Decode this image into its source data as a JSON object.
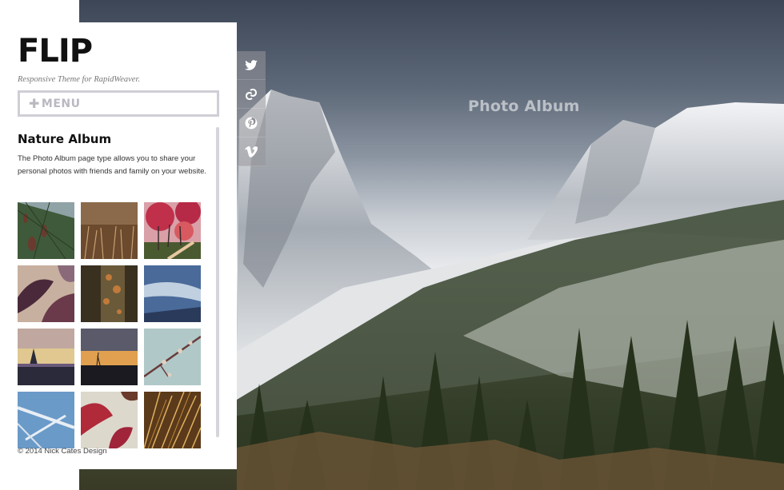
{
  "site": {
    "logo": "FLIP",
    "tagline": "Responsive Theme for RapidWeaver."
  },
  "menu": {
    "label": "MENU",
    "icon": "plus-icon"
  },
  "album": {
    "title": "Nature Album",
    "description": "The Photo Album page type allows you to share your personal photos with friends and family on your website."
  },
  "hero": {
    "title": "Photo Album"
  },
  "social": [
    {
      "name": "twitter-icon"
    },
    {
      "name": "delicious-icon"
    },
    {
      "name": "pinterest-icon"
    },
    {
      "name": "vimeo-icon"
    }
  ],
  "thumbnails": [
    {
      "name": "thumb-pine-cones",
      "colors": [
        "#3f5a3a",
        "#8fa3a6",
        "#6b3a2e"
      ]
    },
    {
      "name": "thumb-dry-grass",
      "colors": [
        "#6b4a2e",
        "#a3805a",
        "#3e2a1c"
      ]
    },
    {
      "name": "thumb-autumn-trees",
      "colors": [
        "#c0304a",
        "#d9a0a8",
        "#4a5a30"
      ]
    },
    {
      "name": "thumb-leaves",
      "colors": [
        "#4a2a3a",
        "#8a6a7a",
        "#c8b0a0"
      ]
    },
    {
      "name": "thumb-bark-lichen",
      "colors": [
        "#3a3020",
        "#c07a3a",
        "#6a5a3a"
      ]
    },
    {
      "name": "thumb-sky-clouds",
      "colors": [
        "#4a6a9a",
        "#c0d0e0",
        "#2a3a5a"
      ]
    },
    {
      "name": "thumb-sunset-tree",
      "colors": [
        "#e0c890",
        "#6a5a7a",
        "#2a2a3a"
      ]
    },
    {
      "name": "thumb-dusk-horizon",
      "colors": [
        "#e0a050",
        "#5a5a6a",
        "#1a1a20"
      ]
    },
    {
      "name": "thumb-blossom-branch",
      "colors": [
        "#b0c8c8",
        "#6a3a3a",
        "#e0d0c0"
      ]
    },
    {
      "name": "thumb-frosted-branch",
      "colors": [
        "#6a9ac8",
        "#e8eef4",
        "#4a6a8a"
      ]
    },
    {
      "name": "thumb-red-leaves",
      "colors": [
        "#b02a3a",
        "#dcd8cc",
        "#6a3a2a"
      ]
    },
    {
      "name": "thumb-golden-grass",
      "colors": [
        "#c08a3a",
        "#5a3a1a",
        "#e0b060"
      ]
    }
  ],
  "footer": {
    "text": "© 2014 Nick Cates Design"
  }
}
